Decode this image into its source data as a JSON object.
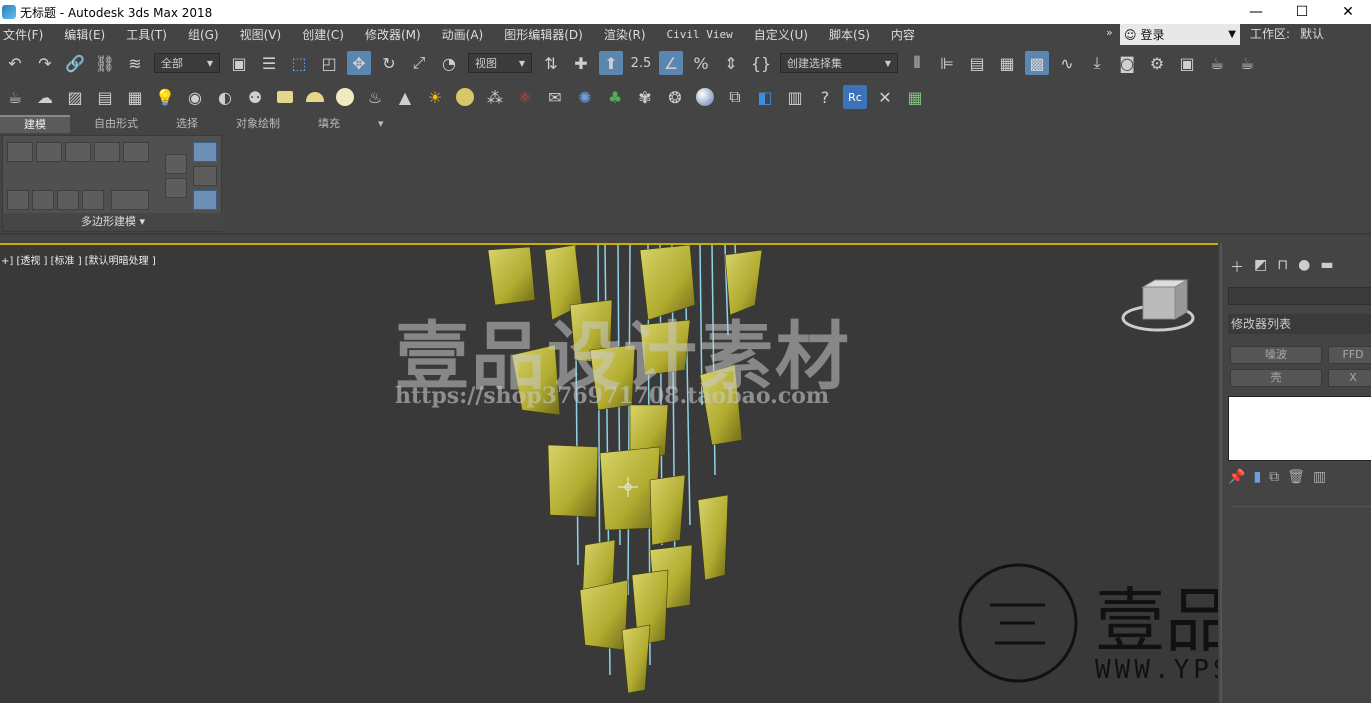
{
  "window": {
    "title": "无标题 - Autodesk 3ds Max 2018",
    "controls": [
      "—",
      "☐",
      "✕"
    ]
  },
  "menu": {
    "items": [
      "文件(F)",
      "编辑(E)",
      "工具(T)",
      "组(G)",
      "视图(V)",
      "创建(C)",
      "修改器(M)",
      "动画(A)",
      "图形编辑器(D)",
      "渲染(R)",
      "Civil View",
      "自定义(U)",
      "脚本(S)",
      "内容"
    ],
    "expand": "»"
  },
  "account": {
    "login_label": "登录",
    "workspace_label": "工作区:",
    "workspace_value": "默认"
  },
  "toolbar1": {
    "selection_filter": "全部",
    "ref_coord": "视图",
    "named_selection": "创建选择集",
    "snap_label": "2.5"
  },
  "ribbon": {
    "tabs": [
      "建模",
      "自由形式",
      "选择",
      "对象绘制",
      "填充"
    ],
    "tab_extra": "▾",
    "panel_label": "多边形建模 ▾"
  },
  "viewport": {
    "label": "+] [透视 ] [标准 ] [默认明暗处理 ]",
    "watermark_title": "壹品设计素材",
    "watermark_url": "https://shop376971708.taobao.com",
    "logo_title": "壹品設計",
    "logo_url": "WWW.YPSUCAI.COM",
    "colors": {
      "cloth": "#b8b33a",
      "string": "#8fd3e8",
      "bg": "#393939"
    }
  },
  "command_panel": {
    "modifier_list": "修改器列表",
    "buttons": [
      "噪波",
      "FFD",
      "壳",
      "X"
    ]
  }
}
